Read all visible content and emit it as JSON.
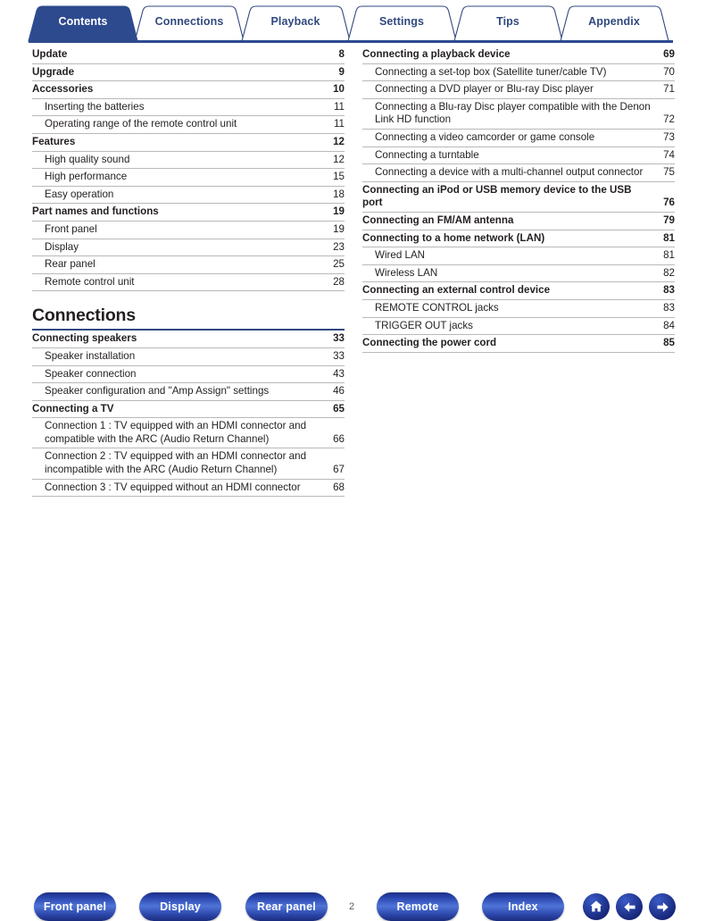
{
  "tabs": [
    {
      "label": "Contents",
      "active": true
    },
    {
      "label": "Connections",
      "active": false
    },
    {
      "label": "Playback",
      "active": false
    },
    {
      "label": "Settings",
      "active": false
    },
    {
      "label": "Tips",
      "active": false
    },
    {
      "label": "Appendix",
      "active": false
    }
  ],
  "colors": {
    "tab_active_bg": "#2e4a8f",
    "tab_text": "#31497f",
    "tab_active_text": "#ffffff",
    "rule": "#31497f",
    "button_blue": "#2a45ad",
    "body_text": "#231f20"
  },
  "left_column": [
    {
      "level": 1,
      "title": "Update",
      "page": "8"
    },
    {
      "level": 1,
      "title": "Upgrade",
      "page": "9"
    },
    {
      "level": 1,
      "title": "Accessories",
      "page": "10"
    },
    {
      "level": 2,
      "title": "Inserting the batteries",
      "page": "11"
    },
    {
      "level": 2,
      "title": "Operating range of the remote control unit",
      "page": "11"
    },
    {
      "level": 1,
      "title": "Features",
      "page": "12"
    },
    {
      "level": 2,
      "title": "High quality sound",
      "page": "12"
    },
    {
      "level": 2,
      "title": "High performance",
      "page": "15"
    },
    {
      "level": 2,
      "title": "Easy operation",
      "page": "18"
    },
    {
      "level": 1,
      "title": "Part names and functions",
      "page": "19"
    },
    {
      "level": 2,
      "title": "Front panel",
      "page": "19"
    },
    {
      "level": 2,
      "title": "Display",
      "page": "23"
    },
    {
      "level": 2,
      "title": "Rear panel",
      "page": "25"
    },
    {
      "level": 2,
      "title": "Remote control unit",
      "page": "28"
    }
  ],
  "section": {
    "title": "Connections"
  },
  "left_column_section2": [
    {
      "level": 1,
      "title": "Connecting speakers",
      "page": "33"
    },
    {
      "level": 2,
      "title": "Speaker installation",
      "page": "33"
    },
    {
      "level": 2,
      "title": "Speaker connection",
      "page": "43"
    },
    {
      "level": 2,
      "title": "Speaker configuration and \"Amp Assign\" settings",
      "page": "46"
    },
    {
      "level": 1,
      "title": "Connecting a TV",
      "page": "65"
    },
    {
      "level": 2,
      "title": "Connection 1 : TV equipped with an HDMI connector and compatible with the ARC (Audio Return Channel)",
      "page": "66"
    },
    {
      "level": 2,
      "title": "Connection 2 : TV equipped with an HDMI connector and incompatible with the ARC (Audio Return Channel)",
      "page": "67"
    },
    {
      "level": 2,
      "title": "Connection 3 : TV equipped without an HDMI connector",
      "page": "68"
    }
  ],
  "right_column": [
    {
      "level": 1,
      "title": "Connecting a playback device",
      "page": "69"
    },
    {
      "level": 2,
      "title": "Connecting a set-top box (Satellite tuner/cable TV)",
      "page": "70"
    },
    {
      "level": 2,
      "title": "Connecting a DVD player or Blu-ray Disc player",
      "page": "71"
    },
    {
      "level": 2,
      "title": "Connecting a Blu-ray Disc player compatible with the Denon Link HD function",
      "page": "72"
    },
    {
      "level": 2,
      "title": "Connecting a video camcorder or game console",
      "page": "73"
    },
    {
      "level": 2,
      "title": "Connecting a turntable",
      "page": "74"
    },
    {
      "level": 2,
      "title": "Connecting a device with a multi-channel output connector",
      "page": "75"
    },
    {
      "level": 1,
      "title": "Connecting an iPod or USB memory device to the USB port",
      "page": "76"
    },
    {
      "level": 1,
      "title": "Connecting an FM/AM antenna",
      "page": "79"
    },
    {
      "level": 1,
      "title": "Connecting to a home network (LAN)",
      "page": "81"
    },
    {
      "level": 2,
      "title": "Wired LAN",
      "page": "81"
    },
    {
      "level": 2,
      "title": "Wireless LAN",
      "page": "82"
    },
    {
      "level": 1,
      "title": "Connecting an external control device",
      "page": "83"
    },
    {
      "level": 2,
      "title": "REMOTE CONTROL jacks",
      "page": "83"
    },
    {
      "level": 2,
      "title": "TRIGGER OUT jacks",
      "page": "84"
    },
    {
      "level": 1,
      "title": "Connecting the power cord",
      "page": "85"
    }
  ],
  "footer": {
    "buttons": [
      {
        "label": "Front panel"
      },
      {
        "label": "Display"
      },
      {
        "label": "Rear panel"
      },
      {
        "label": "Remote"
      },
      {
        "label": "Index"
      }
    ],
    "page_number": "2",
    "icons": [
      {
        "name": "home-icon"
      },
      {
        "name": "arrow-left-icon"
      },
      {
        "name": "arrow-right-icon"
      }
    ]
  }
}
